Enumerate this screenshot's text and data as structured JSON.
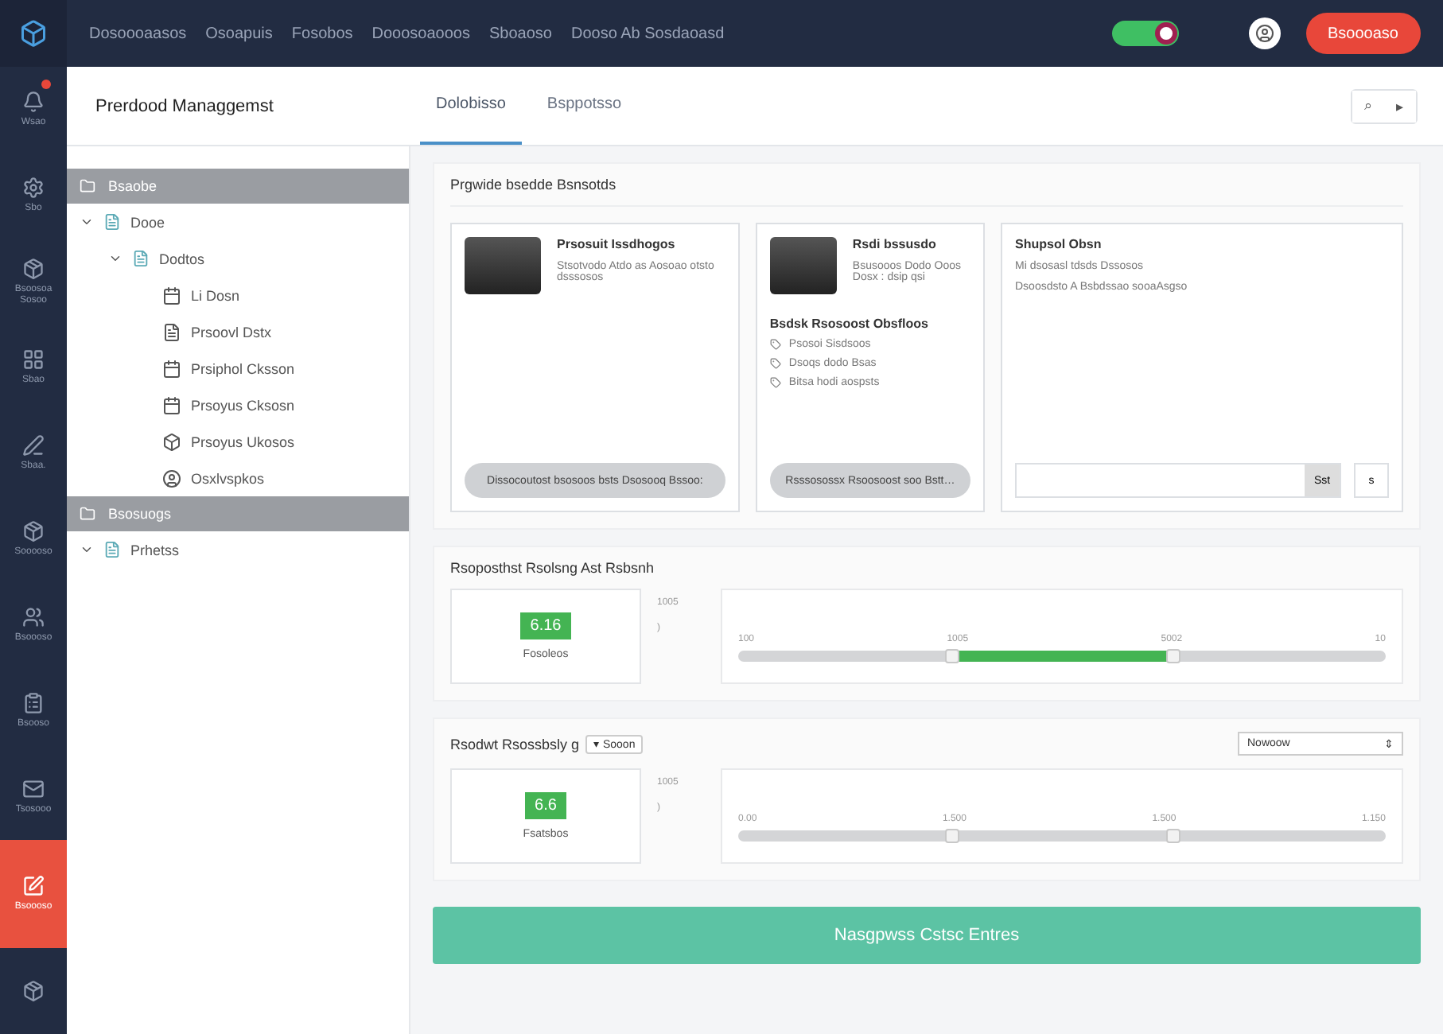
{
  "topbar": {
    "breadcrumbs": [
      "Dosoooaasos",
      "Osoapuis",
      "Fosobos",
      "Dooosoaooos",
      "Sboaoso",
      "Dooso Ab Sosdaoasd"
    ],
    "toggle": {
      "on": true
    },
    "action_button": "Bsoooaso"
  },
  "rail": [
    {
      "label": "Wsao",
      "selected": false,
      "badge": true
    },
    {
      "label": "Sbo",
      "selected": false,
      "badge": false
    },
    {
      "label": "Bsoosoa Sosoo",
      "selected": false,
      "badge": false
    },
    {
      "label": "Sbao",
      "selected": false,
      "badge": false
    },
    {
      "label": "Sbaa.",
      "selected": false,
      "badge": false
    },
    {
      "label": "Sooooso",
      "selected": false,
      "badge": false
    },
    {
      "label": "Bsoooso",
      "selected": false,
      "badge": false
    },
    {
      "label": "Bsooso",
      "selected": false,
      "badge": false
    },
    {
      "label": "Tsosooo",
      "selected": false,
      "badge": false
    },
    {
      "label": "Bsoooso",
      "selected": true,
      "badge": false
    },
    {
      "selected": false,
      "badge": false
    }
  ],
  "header": {
    "title": "Prerdood Managgemst",
    "tabs": [
      {
        "label": "Dolobisso",
        "selected": true
      },
      {
        "label": "Bsppotsso",
        "selected": false
      }
    ],
    "tools": [
      "⌕",
      "▸"
    ]
  },
  "tree": [
    {
      "kind": "group",
      "label": "Bsaobe"
    },
    {
      "kind": "node",
      "label": "Dooe",
      "expanded": true,
      "children": [
        {
          "kind": "node",
          "label": "Dodtos",
          "expanded": true,
          "children": [
            {
              "kind": "leaf",
              "label": "Li Dosn"
            },
            {
              "kind": "leaf",
              "label": "Prsoovl Dstx"
            },
            {
              "kind": "leaf",
              "label": "Prsiphol Cksson"
            },
            {
              "kind": "leaf",
              "label": "Prsoyus Cksosn"
            },
            {
              "kind": "leaf",
              "label": "Prsoyus Ukosos"
            },
            {
              "kind": "leaf",
              "label": "Osxlvspkos"
            }
          ]
        }
      ]
    },
    {
      "kind": "group",
      "label": "Bsosuogs"
    },
    {
      "kind": "node",
      "label": "Prhetss",
      "expanded": true
    }
  ],
  "products": {
    "title": "Prgwide bsedde Bsnsotds",
    "cards": [
      {
        "kind": "product",
        "title": "Prsosuit Issdhogos",
        "description": "Stsotvodo Atdo as Aosoao otsto dsssosos",
        "button": "Dissocoutost bsosoos bsts Dsosooq Bssoo:"
      },
      {
        "kind": "product",
        "title": "Rsdi bssusdo",
        "description": "Bsusooos Dodo Ooos Dosx : dsip qsi",
        "subtitle": "Bsdsk Rsosoost Obsfloos",
        "items": [
          "Psosoi Sisdsoos",
          "Dsoqs dodo Bsas",
          "Bitsa hodi aospsts"
        ],
        "button": "Rsssosossx Rsoosoost soo Bstt…"
      },
      {
        "kind": "note",
        "title": "Shupsol Obsn",
        "lines": [
          "Mi dsosasl tdsds Dssosos",
          "Dsoosdsto A Bsbdssao sooaAsgso"
        ],
        "send": "Sst",
        "extra": "s"
      }
    ]
  },
  "filters": [
    {
      "title": "Rsoposthst Rsolsng Ast Rsbsnh",
      "metric": {
        "value": "6.16",
        "label": "Fosoleos"
      },
      "axis": [
        "1005",
        ")"
      ],
      "slider": {
        "ticks": [
          "100",
          "1005",
          "5002",
          "10"
        ],
        "filled": true,
        "handles": [
          {
            "level": 0.33
          },
          {
            "level": 0.67
          }
        ]
      }
    },
    {
      "title": "Rsodwt Rsossbsly g",
      "chip": "▾ Sooon",
      "select": {
        "value": "Nowoow",
        "arrow": "⇕"
      },
      "metric": {
        "value": "6.6",
        "label": "Fsatsbos"
      },
      "axis": [
        "1005",
        ")"
      ],
      "slider": {
        "ticks": [
          "0.00",
          "1.500",
          "1.500",
          "1.150"
        ],
        "filled": false,
        "handles": [
          {
            "level": 0.33
          },
          {
            "level": 0.67
          }
        ]
      }
    }
  ],
  "primary_button": "Nasgpwss Cstsc Entres"
}
